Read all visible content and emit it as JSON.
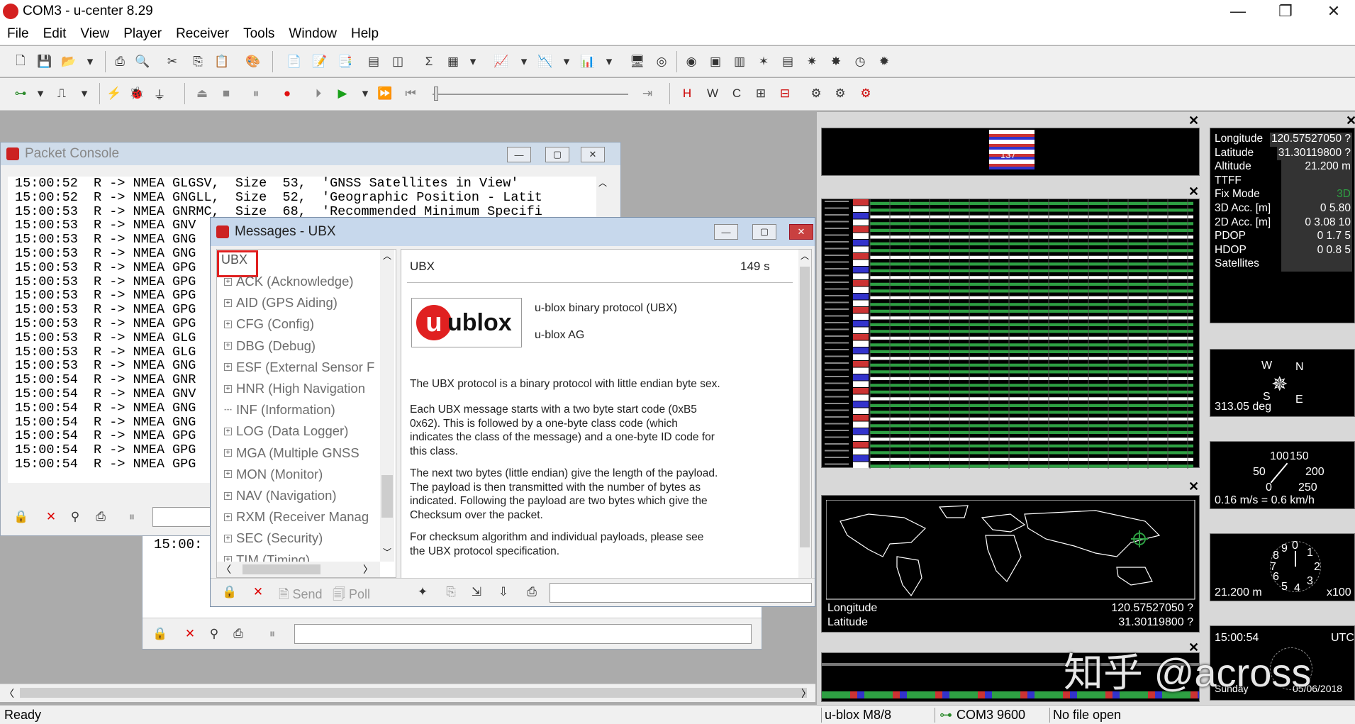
{
  "window": {
    "title": "COM3 - u-center 8.29"
  },
  "menu": [
    "File",
    "Edit",
    "View",
    "Player",
    "Receiver",
    "Tools",
    "Window",
    "Help"
  ],
  "packet_console": {
    "title": "Packet Console",
    "lines": [
      "15:00:52  R -> NMEA GLGSV,  Size  53,  'GNSS Satellites in View'",
      "15:00:52  R -> NMEA GNGLL,  Size  52,  'Geographic Position - Latit",
      "15:00:53  R -> NMEA GNRMC,  Size  68,  'Recommended Minimum Specifi",
      "15:00:53  R -> NMEA GNV",
      "15:00:53  R -> NMEA GNG",
      "15:00:53  R -> NMEA GNG",
      "15:00:53  R -> NMEA GPG",
      "15:00:53  R -> NMEA GPG",
      "15:00:53  R -> NMEA GPG",
      "15:00:53  R -> NMEA GPG",
      "15:00:53  R -> NMEA GPG",
      "15:00:53  R -> NMEA GLG",
      "15:00:53  R -> NMEA GLG",
      "15:00:53  R -> NMEA GNG",
      "15:00:54  R -> NMEA GNR",
      "15:00:54  R -> NMEA GNV",
      "15:00:54  R -> NMEA GNG",
      "15:00:54  R -> NMEA GNG",
      "15:00:54  R -> NMEA GPG",
      "15:00:54  R -> NMEA GPG",
      "15:00:54  R -> NMEA GPG"
    ]
  },
  "back_console": {
    "line": "15:00:"
  },
  "messages": {
    "title": "Messages - UBX",
    "tree_root": "UBX",
    "tree": [
      {
        "label": "ACK (Acknowledge)",
        "expand": true
      },
      {
        "label": "AID (GPS Aiding)",
        "expand": true
      },
      {
        "label": "CFG (Config)",
        "expand": true
      },
      {
        "label": "DBG (Debug)",
        "expand": true
      },
      {
        "label": "ESF (External Sensor F",
        "expand": true
      },
      {
        "label": "HNR (High Navigation",
        "expand": true
      },
      {
        "label": "INF (Information)",
        "expand": false
      },
      {
        "label": "LOG (Data Logger)",
        "expand": true
      },
      {
        "label": "MGA (Multiple GNSS",
        "expand": true
      },
      {
        "label": "MON (Monitor)",
        "expand": true
      },
      {
        "label": "NAV (Navigation)",
        "expand": true
      },
      {
        "label": "RXM (Receiver Manag",
        "expand": true
      },
      {
        "label": "SEC (Security)",
        "expand": true
      },
      {
        "label": "TIM (Timing)",
        "expand": true
      }
    ],
    "header_label": "UBX",
    "header_age": "149 s",
    "logo_text": "ublox",
    "logo_u": "u",
    "proto_name": "u-blox binary protocol (UBX)",
    "company": "u-blox AG",
    "p1": "The UBX protocol is a binary protocol with little endian byte sex.",
    "p2": "Each UBX message starts with a two byte start code (0xB5 0x62). This is followed by a one-byte class code (which indicates the class of the message) and a one-byte ID code for this class.",
    "p3": "The next two bytes (little endian) give the length of the payload. The payload is then transmitted with the number of bytes as indicated. Following the payload are two bytes which give the Checksum over the packet.",
    "p4": "For checksum algorithm and individual payloads, please see the UBX protocol specification.",
    "send_label": "Send",
    "poll_label": "Poll"
  },
  "data_panel": {
    "rows": [
      {
        "label": "Longitude",
        "value": "120.57527050 ?"
      },
      {
        "label": "Latitude",
        "value": "31.30119800 ?"
      },
      {
        "label": "Altitude",
        "value": "21.200 m"
      },
      {
        "label": "TTFF",
        "value": ""
      },
      {
        "label": "Fix Mode",
        "value": "3D"
      },
      {
        "label": "3D Acc. [m]",
        "value": "0    5.80"
      },
      {
        "label": "2D Acc. [m]",
        "value": "0  3.08  10"
      },
      {
        "label": "PDOP",
        "value": "0   1.7   5"
      },
      {
        "label": "HDOP",
        "value": "0  0.8    5"
      },
      {
        "label": "Satellites",
        "value": ""
      }
    ]
  },
  "compass": {
    "heading": "313.05 deg",
    "w": "W",
    "n": "N",
    "s": "S",
    "e": "E"
  },
  "speedo": {
    "text": "0.16 m/s = 0.6 km/h",
    "t100": "100",
    "t150": "150",
    "t50": "50",
    "t200": "200",
    "t0": "0",
    "t250": "250"
  },
  "altimeter": {
    "text": "21.200 m",
    "scale": "x100",
    "nums": [
      "0",
      "1",
      "2",
      "3",
      "4",
      "5",
      "6",
      "7",
      "8",
      "9"
    ]
  },
  "clock": {
    "time": "15:00:54",
    "zone": "UTC",
    "day": "Sunday",
    "date": "05/06/2018"
  },
  "world_map": {
    "lon_label": "Longitude",
    "lon_value": "120.57527050 ?",
    "lat_label": "Latitude",
    "lat_value": "31.30119800 ?"
  },
  "sky_badge": "137",
  "status": {
    "ready": "Ready",
    "receiver": "u-blox M8/8",
    "port": "COM3 9600",
    "file": "No file open"
  },
  "watermark": "知乎 @across",
  "colors": {
    "accent_red": "#d42020",
    "highlight_box": "#e02020",
    "signal_green": "#2ea043"
  }
}
